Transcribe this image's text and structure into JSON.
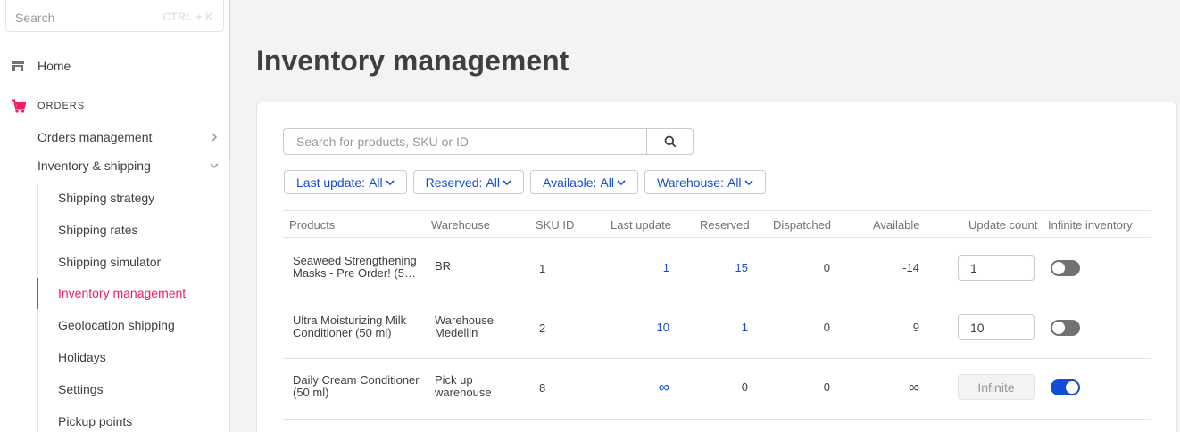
{
  "sidebar": {
    "search": {
      "placeholder": "Search",
      "shortcut": "CTRL + K"
    },
    "home": {
      "label": "Home",
      "icon": "store-icon"
    },
    "orders_section": {
      "label": "ORDERS",
      "icon": "cart-icon",
      "accent": "#f71963"
    },
    "links": [
      {
        "label": "Orders management",
        "icon": "chevron-right-icon"
      },
      {
        "label": "Inventory & shipping",
        "icon": "chevron-down-icon"
      }
    ],
    "subitems": [
      {
        "label": "Shipping strategy",
        "active": false
      },
      {
        "label": "Shipping rates",
        "active": false
      },
      {
        "label": "Shipping simulator",
        "active": false
      },
      {
        "label": "Inventory management",
        "active": true
      },
      {
        "label": "Geolocation shipping",
        "active": false
      },
      {
        "label": "Holidays",
        "active": false
      },
      {
        "label": "Settings",
        "active": false
      },
      {
        "label": "Pickup points",
        "active": false
      }
    ]
  },
  "page": {
    "title": "Inventory management"
  },
  "product_search": {
    "placeholder": "Search for products, SKU or ID",
    "icon": "search-icon"
  },
  "filters": [
    {
      "label": "Last update:",
      "value": "All"
    },
    {
      "label": "Reserved:",
      "value": "All"
    },
    {
      "label": "Available:",
      "value": "All"
    },
    {
      "label": "Warehouse:",
      "value": "All"
    }
  ],
  "table": {
    "columns": [
      "Products",
      "Warehouse",
      "SKU ID",
      "Last update",
      "Reserved",
      "Dispatched",
      "Available",
      "Update count",
      "Infinite inventory"
    ],
    "rows": [
      {
        "product": [
          "Seaweed Strengthening",
          "Masks - Pre Order! (50…"
        ],
        "warehouse": [
          "BR",
          ""
        ],
        "sku": "1",
        "last_update": "1",
        "reserved": "15",
        "dispatched": "0",
        "available": "-14",
        "update_count": "1",
        "infinite": false
      },
      {
        "product": [
          "Ultra Moisturizing Milk",
          "Conditioner (50 ml)"
        ],
        "warehouse": [
          "Warehouse",
          "Medellin"
        ],
        "sku": "2",
        "last_update": "10",
        "reserved": "1",
        "dispatched": "0",
        "available": "9",
        "update_count": "10",
        "infinite": false
      },
      {
        "product": [
          "Daily Cream Conditioner",
          "(50 ml)"
        ],
        "warehouse": [
          "Pick up",
          "warehouse"
        ],
        "sku": "8",
        "last_update": "∞",
        "reserved": "0",
        "dispatched": "0",
        "available": "∞",
        "update_count": "Infinite",
        "infinite": true
      }
    ]
  },
  "colors": {
    "accent": "#f71963",
    "link": "#134cd8",
    "toggle_off": "#727273"
  }
}
